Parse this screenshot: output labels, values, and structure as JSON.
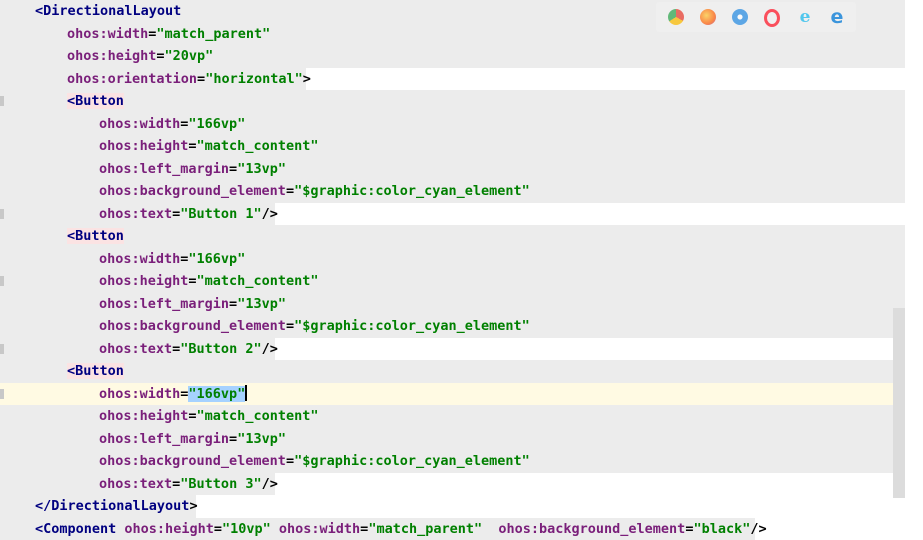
{
  "editor": {
    "code_lines": [
      {
        "tokens": [
          [
            "tag",
            "<DirectionalLayout"
          ]
        ]
      },
      {
        "tokens": [
          [
            "attr",
            "ohos:width"
          ],
          [
            "punct",
            "="
          ],
          [
            "val",
            "\"match_parent\""
          ]
        ]
      },
      {
        "tokens": [
          [
            "attr",
            "ohos:height"
          ],
          [
            "punct",
            "="
          ],
          [
            "val",
            "\"20vp\""
          ]
        ]
      },
      {
        "tokens": [
          [
            "attr",
            "ohos:orientation"
          ],
          [
            "punct",
            "="
          ],
          [
            "val",
            "\"horizontal\""
          ],
          [
            "punct",
            ">"
          ]
        ]
      },
      {
        "tokens": [
          [
            "tag",
            "<Button"
          ]
        ]
      },
      {
        "tokens": [
          [
            "attr",
            "ohos:width"
          ],
          [
            "punct",
            "="
          ],
          [
            "val",
            "\"166vp\""
          ]
        ]
      },
      {
        "tokens": [
          [
            "attr",
            "ohos:height"
          ],
          [
            "punct",
            "="
          ],
          [
            "val",
            "\"match_content\""
          ]
        ]
      },
      {
        "tokens": [
          [
            "attr",
            "ohos:left_margin"
          ],
          [
            "punct",
            "="
          ],
          [
            "val",
            "\"13vp\""
          ]
        ]
      },
      {
        "tokens": [
          [
            "attr",
            "ohos:background_element"
          ],
          [
            "punct",
            "="
          ],
          [
            "val",
            "\"$graphic:color_cyan_element\""
          ]
        ]
      },
      {
        "tokens": [
          [
            "attr",
            "ohos:text"
          ],
          [
            "punct",
            "="
          ],
          [
            "val",
            "\"Button 1\""
          ],
          [
            "punct",
            "/>"
          ]
        ]
      },
      {
        "tokens": [
          [
            "tag",
            "<Button"
          ]
        ]
      },
      {
        "tokens": [
          [
            "attr",
            "ohos:width"
          ],
          [
            "punct",
            "="
          ],
          [
            "val",
            "\"166vp\""
          ]
        ]
      },
      {
        "tokens": [
          [
            "attr",
            "ohos:height"
          ],
          [
            "punct",
            "="
          ],
          [
            "val",
            "\"match_content\""
          ]
        ]
      },
      {
        "tokens": [
          [
            "attr",
            "ohos:left_margin"
          ],
          [
            "punct",
            "="
          ],
          [
            "val",
            "\"13vp\""
          ]
        ]
      },
      {
        "tokens": [
          [
            "attr",
            "ohos:background_element"
          ],
          [
            "punct",
            "="
          ],
          [
            "val",
            "\"$graphic:color_cyan_element\""
          ]
        ]
      },
      {
        "tokens": [
          [
            "attr",
            "ohos:text"
          ],
          [
            "punct",
            "="
          ],
          [
            "val",
            "\"Button 2\""
          ],
          [
            "punct",
            "/>"
          ]
        ]
      },
      {
        "tokens": [
          [
            "tag",
            "<Button"
          ]
        ]
      },
      {
        "tokens": [
          [
            "attr",
            "ohos:width"
          ],
          [
            "punct",
            "="
          ],
          [
            "val",
            "\"166vp\""
          ]
        ]
      },
      {
        "tokens": [
          [
            "attr",
            "ohos:height"
          ],
          [
            "punct",
            "="
          ],
          [
            "val",
            "\"match_content\""
          ]
        ]
      },
      {
        "tokens": [
          [
            "attr",
            "ohos:left_margin"
          ],
          [
            "punct",
            "="
          ],
          [
            "val",
            "\"13vp\""
          ]
        ]
      },
      {
        "tokens": [
          [
            "attr",
            "ohos:background_element"
          ],
          [
            "punct",
            "="
          ],
          [
            "val",
            "\"$graphic:color_cyan_element\""
          ]
        ]
      },
      {
        "tokens": [
          [
            "attr",
            "ohos:text"
          ],
          [
            "punct",
            "="
          ],
          [
            "val",
            "\"Button 3\""
          ],
          [
            "punct",
            "/>"
          ]
        ]
      },
      {
        "tokens": [
          [
            "tag",
            "</DirectionalLayout"
          ],
          [
            "punct",
            ">"
          ]
        ]
      },
      {
        "tokens": [
          [
            "tag",
            "<Component"
          ],
          [
            "plain",
            " "
          ],
          [
            "attr",
            "ohos:height"
          ],
          [
            "punct",
            "="
          ],
          [
            "val",
            "\"10vp\""
          ],
          [
            "plain",
            " "
          ],
          [
            "attr",
            "ohos:width"
          ],
          [
            "punct",
            "="
          ],
          [
            "val",
            "\"match_parent\""
          ],
          [
            "plain",
            "  "
          ],
          [
            "attr",
            "ohos:background_element"
          ],
          [
            "punct",
            "="
          ],
          [
            "val",
            "\"black\""
          ],
          [
            "punct",
            "/>"
          ]
        ]
      }
    ]
  },
  "browser_icons": [
    "chrome-icon",
    "firefox-icon",
    "safari-icon",
    "opera-icon",
    "ie-icon",
    "edge-icon"
  ],
  "colors": {
    "tag": "#000080",
    "attribute": "#7a1f7a",
    "value": "#008000",
    "current_line": "#fffae3",
    "selection": "#a6d2ff"
  }
}
